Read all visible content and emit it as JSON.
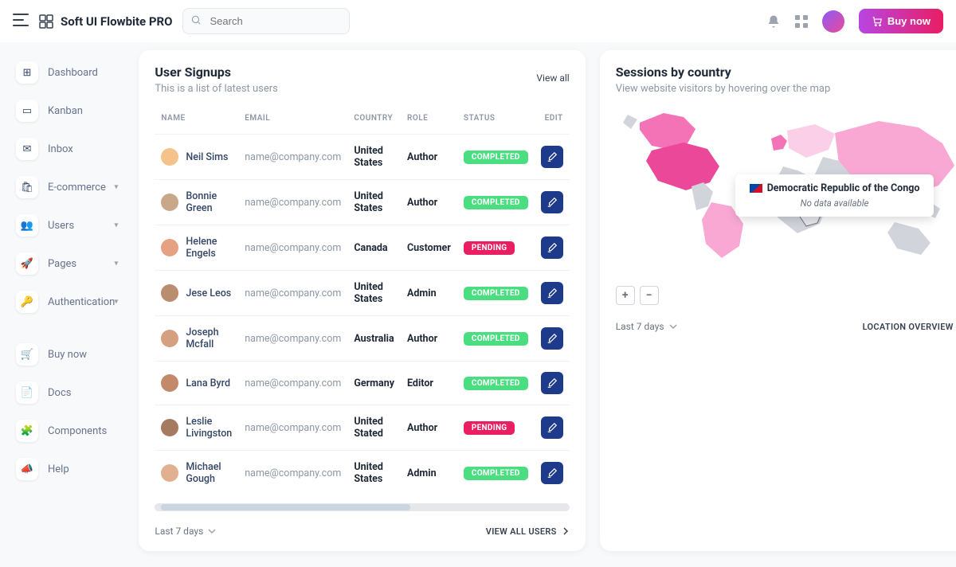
{
  "header": {
    "brand": "Soft UI Flowbite PRO",
    "search_placeholder": "Search",
    "buy_label": "Buy now"
  },
  "sidebar": {
    "items": [
      {
        "icon": "⊞",
        "label": "Dashboard",
        "chev": false
      },
      {
        "icon": "▭",
        "label": "Kanban",
        "chev": false
      },
      {
        "icon": "✉",
        "label": "Inbox",
        "chev": false
      },
      {
        "icon": "🛍",
        "label": "E-commerce",
        "chev": true
      },
      {
        "icon": "👥",
        "label": "Users",
        "chev": true
      },
      {
        "icon": "🚀",
        "label": "Pages",
        "chev": true
      },
      {
        "icon": "🔑",
        "label": "Authentication",
        "chev": true
      }
    ],
    "footer": [
      {
        "icon": "🛒",
        "label": "Buy now"
      },
      {
        "icon": "📄",
        "label": "Docs"
      },
      {
        "icon": "🧩",
        "label": "Components"
      },
      {
        "icon": "📣",
        "label": "Help"
      }
    ]
  },
  "signups": {
    "title": "User Signups",
    "subtitle": "This is a list of latest users",
    "view_all": "View all",
    "columns": {
      "name": "NAME",
      "email": "EMAIL",
      "country": "COUNTRY",
      "role": "ROLE",
      "status": "STATUS",
      "edit": "EDIT"
    },
    "rows": [
      {
        "name": "Neil Sims",
        "email": "name@company.com",
        "country": "United States",
        "role": "Author",
        "status": "COMPLETED",
        "color": "#f4c28a"
      },
      {
        "name": "Bonnie Green",
        "email": "name@company.com",
        "country": "United States",
        "role": "Author",
        "status": "COMPLETED",
        "color": "#c9a88a"
      },
      {
        "name": "Helene Engels",
        "email": "name@company.com",
        "country": "Canada",
        "role": "Customer",
        "status": "PENDING",
        "color": "#e6a082"
      },
      {
        "name": "Jese Leos",
        "email": "name@company.com",
        "country": "United States",
        "role": "Admin",
        "status": "COMPLETED",
        "color": "#b88d70"
      },
      {
        "name": "Joseph Mcfall",
        "email": "name@company.com",
        "country": "Australia",
        "role": "Author",
        "status": "COMPLETED",
        "color": "#d4a080"
      },
      {
        "name": "Lana Byrd",
        "email": "name@company.com",
        "country": "Germany",
        "role": "Editor",
        "status": "COMPLETED",
        "color": "#c28a6a"
      },
      {
        "name": "Leslie Livingston",
        "email": "name@company.com",
        "country": "United Stated",
        "role": "Author",
        "status": "PENDING",
        "color": "#a67a5e"
      },
      {
        "name": "Michael Gough",
        "email": "name@company.com",
        "country": "United States",
        "role": "Admin",
        "status": "COMPLETED",
        "color": "#e0b090"
      }
    ],
    "footer_left": "Last 7 days",
    "footer_right": "VIEW ALL USERS"
  },
  "map": {
    "title": "Sessions by country",
    "subtitle": "View website visitors by hovering over the map",
    "tooltip_country": "Democratic Republic of the Congo",
    "tooltip_msg": "No data available",
    "footer_left": "Last 7 days",
    "footer_right": "LOCATION OVERVIEW"
  }
}
